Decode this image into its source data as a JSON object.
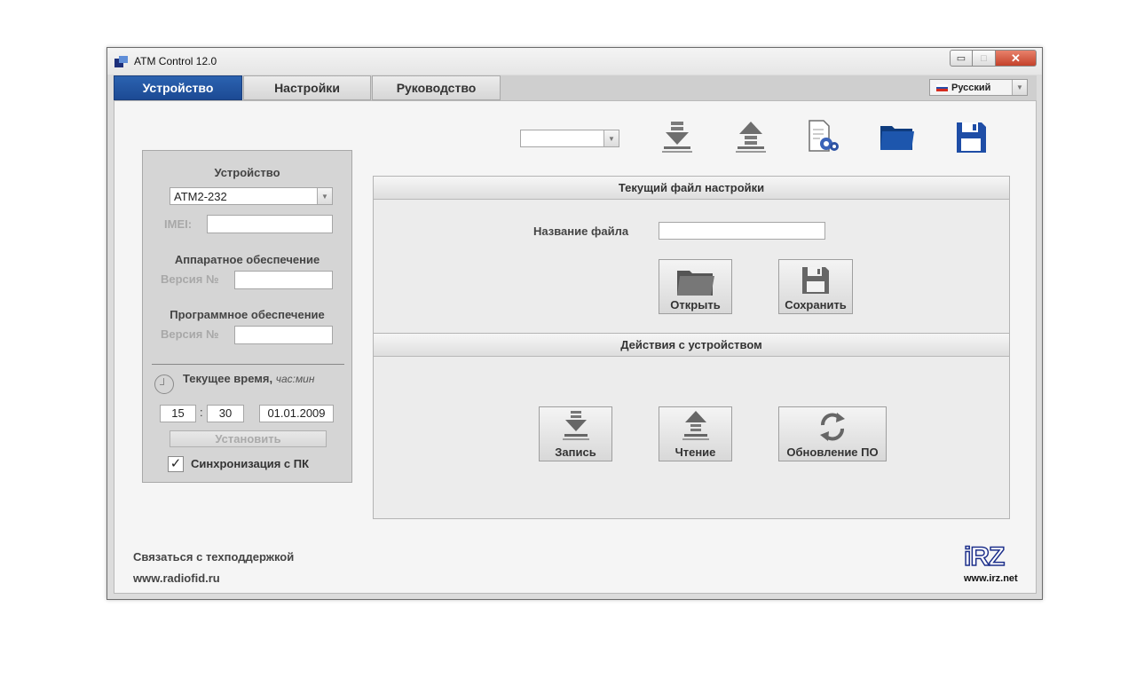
{
  "window": {
    "title": "ATM Control 12.0"
  },
  "tabs": [
    {
      "label": "Устройство"
    },
    {
      "label": "Настройки"
    },
    {
      "label": "Руководство"
    }
  ],
  "language": {
    "selected": "Русский"
  },
  "device_panel": {
    "device_heading": "Устройство",
    "device_selected": "ATM2-232",
    "imei_label": "IMEI:",
    "imei_value": "",
    "hardware_heading": "Аппаратное обеспечение",
    "hardware_version_label": "Версия №",
    "software_heading": "Программное обеспечение",
    "software_version_label": "Версия №",
    "time_heading": "Текущее время,",
    "time_units": "час:мин",
    "hours": "15",
    "minutes": "30",
    "date": "01.01.2009",
    "set_button": "Установить",
    "sync_label": "Синхронизация с ПК",
    "sync_checked": true
  },
  "toolbar": {
    "icons": [
      "download-icon",
      "upload-icon",
      "settings-file-icon",
      "open-folder-icon",
      "save-icon"
    ]
  },
  "settings_file_section": {
    "heading": "Текущий файл настройки",
    "file_name_label": "Название файла",
    "file_name_value": "",
    "open_button": "Открыть",
    "save_button": "Сохранить"
  },
  "device_actions_section": {
    "heading": "Действия с устройством",
    "write_button": "Запись",
    "read_button": "Чтение",
    "update_button": "Обновление ПО"
  },
  "footer": {
    "support_link": "Связаться с техподдержкой",
    "site_link": "www.radiofid.ru",
    "logo_text": "iRZ",
    "logo_url": "www.irz.net"
  },
  "colors": {
    "active_tab": "#1c4a94",
    "brand_logo": "#1c2f8a",
    "icon_gray": "#6e6e6e"
  }
}
